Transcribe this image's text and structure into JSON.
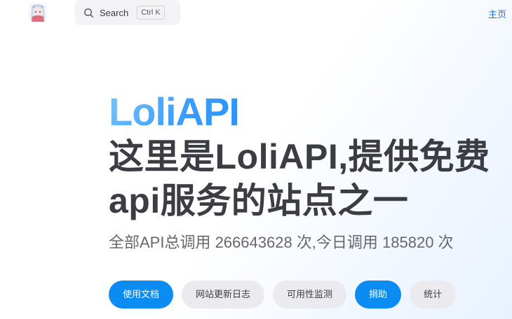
{
  "navbar": {
    "logo_icon": "anime-girl-avatar",
    "search": {
      "label": "Search",
      "shortcut": "Ctrl K",
      "icon": "search-icon"
    },
    "links": [
      {
        "label": "主页"
      }
    ]
  },
  "hero": {
    "name": "LoliAPI",
    "text": "这里是LoliAPI,提供免费api服务的站点之一",
    "tagline": "全部API总调用 266643628 次,今日调用 185820 次"
  },
  "actions": [
    {
      "label": "使用文档",
      "theme": "brand"
    },
    {
      "label": "网站更新日志",
      "theme": "alt"
    },
    {
      "label": "可用性监测",
      "theme": "alt"
    },
    {
      "label": "捐助",
      "theme": "brand"
    },
    {
      "label": "统计",
      "theme": "alt"
    }
  ],
  "colors": {
    "brand": "#0b8cf2",
    "text": "#3c3c43",
    "link": "#1f6fd6"
  }
}
